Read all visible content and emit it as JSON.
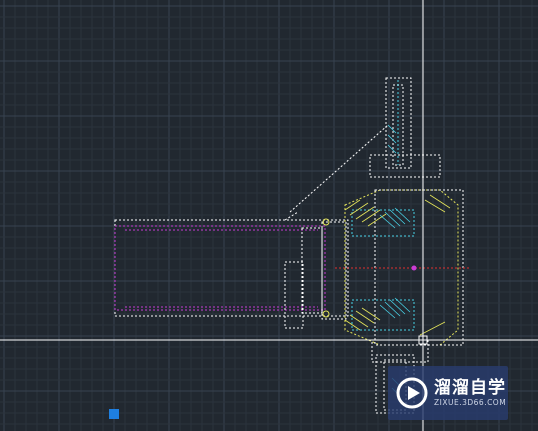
{
  "watermark": {
    "title": "溜溜自学",
    "url": "ZIXUE.3D66.COM"
  },
  "colors": {
    "background": "#212830",
    "grid_minor": "#2b333d",
    "grid_major": "#384250",
    "crosshair": "#ffffff",
    "outline": "#ffffff",
    "magenta": "#c83cd6",
    "yellow": "#e6e65a",
    "cyan": "#48d2e6",
    "red": "#e03030",
    "grip": "#1e7fe0"
  }
}
